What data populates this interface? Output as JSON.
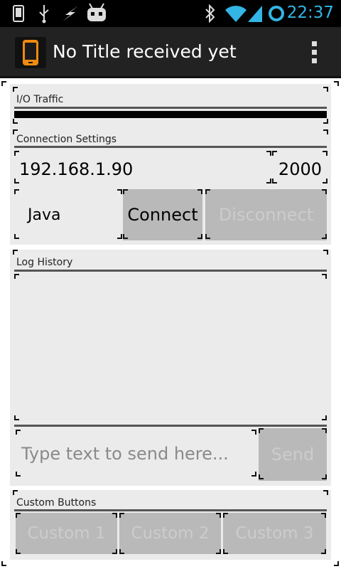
{
  "status_bar": {
    "time": "22:37",
    "icons": [
      "phone-icon",
      "usb-icon",
      "charging-icon",
      "android-face-icon",
      "bluetooth-icon",
      "wifi-icon",
      "signal-icon",
      "sync-ring-icon"
    ],
    "accent_color": "#33b5e5"
  },
  "action_bar": {
    "title": "No Title received yet",
    "app_icon": "phone-app-icon",
    "overflow_icon": "overflow-menu-icon"
  },
  "io_traffic": {
    "label": "I/O Traffic"
  },
  "connection": {
    "label": "Connection Settings",
    "ip": "192.168.1.90",
    "port": "2000",
    "mode": "Java",
    "connect_label": "Connect",
    "disconnect_label": "Disconnect"
  },
  "log": {
    "label": "Log History",
    "entries": []
  },
  "send": {
    "placeholder": "Type text to send here...",
    "send_label": "Send"
  },
  "custom": {
    "label": "Custom Buttons",
    "buttons": [
      "Custom 1",
      "Custom 2",
      "Custom 3"
    ]
  }
}
